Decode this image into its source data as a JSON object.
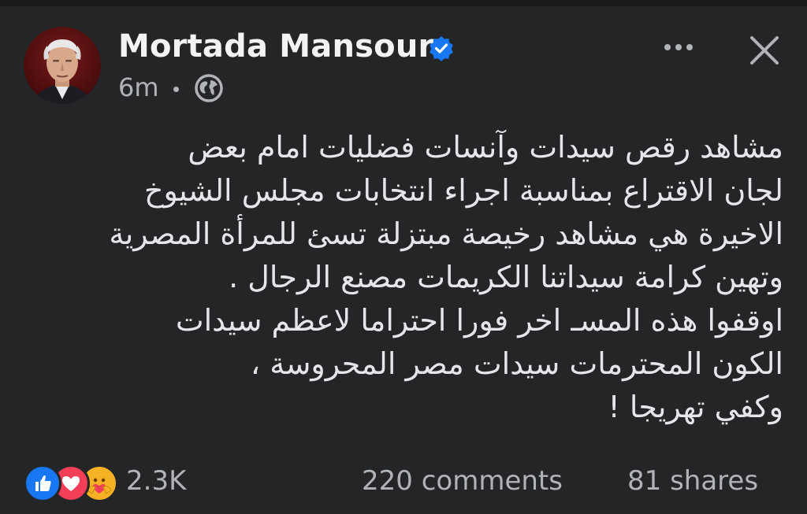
{
  "post": {
    "author": {
      "name": "Mortada Mansour",
      "verified": true,
      "avatar_icon": "profile-photo"
    },
    "meta": {
      "time": "6m",
      "audience_icon": "globe-icon"
    },
    "header_actions": {
      "more_icon": "ellipsis-icon",
      "close_icon": "close-icon"
    },
    "body_lines": [
      "مشاهد رقص سيدات وآنسات فضليات امام بعض",
      "لجان الاقتراع بمناسبة اجراء انتخابات مجلس الشيوخ",
      "الاخيرة هي مشاهد رخيصة مبتزلة تسئ للمرأة المصرية",
      "وتهين كرامة سيداتنا الكريمات  مصنع الرجال .",
      "اوقفوا هذه المسـ اخر فورا احتراما لاعظم سيدات",
      "الكون المحترمات سيدات مصر المحروسة ،",
      "وكفي تهريجا !"
    ],
    "stats": {
      "reaction_icons": [
        "like-icon",
        "love-icon",
        "care-icon"
      ],
      "reactions": "2.3K",
      "comments": "220 comments",
      "shares": "81 shares"
    }
  },
  "colors": {
    "background": "#242526",
    "primary_text": "#e4e6eb",
    "secondary_text": "#b0b3b8",
    "verified_blue": "#1877f2",
    "like_blue": "#1877f2",
    "love_red": "#f33e58",
    "care_yellow": "#f7b125"
  }
}
